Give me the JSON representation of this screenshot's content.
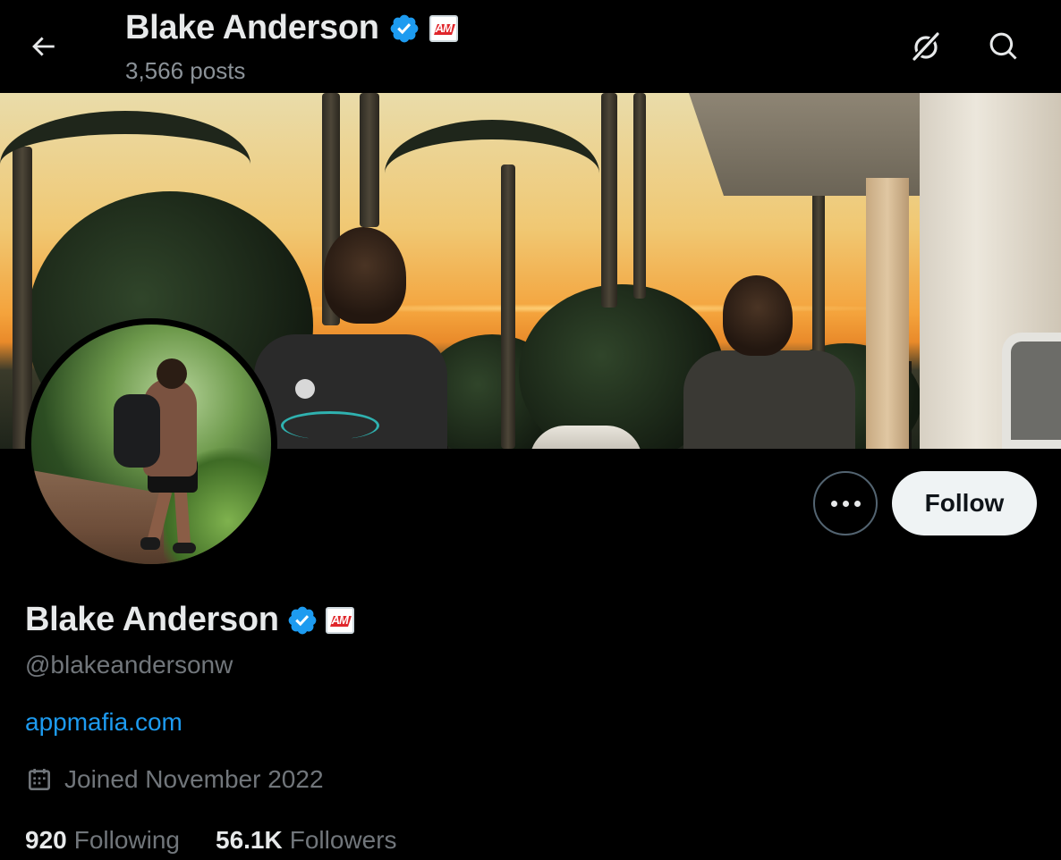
{
  "header": {
    "title": "Blake Anderson",
    "posts_count": "3,566 posts",
    "back_icon": "arrow-left-icon",
    "grok_icon": "grok-icon",
    "search_icon": "search-icon"
  },
  "badges": {
    "verified_color": "#1d9bf0",
    "affiliate_text": "AM"
  },
  "profile": {
    "display_name": "Blake Anderson",
    "handle": "@blakeandersonw",
    "website": "appmafia.com",
    "joined": "Joined November 2022",
    "following_count": "920",
    "following_label": "Following",
    "followers_count": "56.1K",
    "followers_label": "Followers"
  },
  "actions": {
    "follow_label": "Follow",
    "more_icon": "more-horizontal-icon"
  },
  "colors": {
    "background": "#000000",
    "text_primary": "#e7e9ea",
    "text_secondary": "#71767b",
    "link": "#1d9bf0",
    "follow_button_bg": "#eff3f4"
  }
}
